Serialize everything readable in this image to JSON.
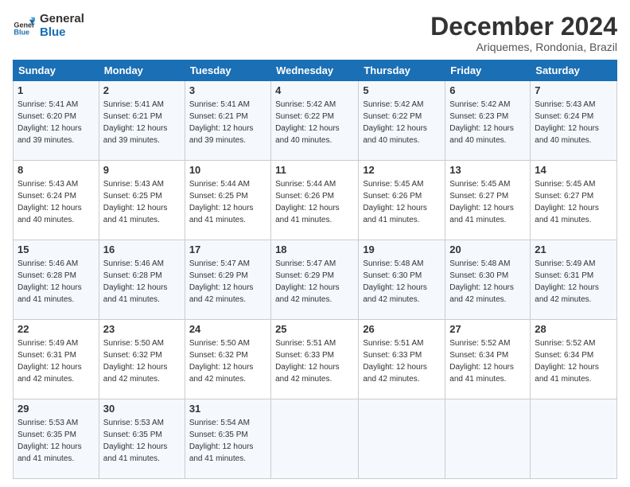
{
  "logo": {
    "text_general": "General",
    "text_blue": "Blue"
  },
  "header": {
    "month": "December 2024",
    "location": "Ariquemes, Rondonia, Brazil"
  },
  "days_of_week": [
    "Sunday",
    "Monday",
    "Tuesday",
    "Wednesday",
    "Thursday",
    "Friday",
    "Saturday"
  ],
  "weeks": [
    [
      {
        "day": "1",
        "sunrise": "5:41 AM",
        "sunset": "6:20 PM",
        "daylight": "12 hours and 39 minutes."
      },
      {
        "day": "2",
        "sunrise": "5:41 AM",
        "sunset": "6:21 PM",
        "daylight": "12 hours and 39 minutes."
      },
      {
        "day": "3",
        "sunrise": "5:41 AM",
        "sunset": "6:21 PM",
        "daylight": "12 hours and 39 minutes."
      },
      {
        "day": "4",
        "sunrise": "5:42 AM",
        "sunset": "6:22 PM",
        "daylight": "12 hours and 40 minutes."
      },
      {
        "day": "5",
        "sunrise": "5:42 AM",
        "sunset": "6:22 PM",
        "daylight": "12 hours and 40 minutes."
      },
      {
        "day": "6",
        "sunrise": "5:42 AM",
        "sunset": "6:23 PM",
        "daylight": "12 hours and 40 minutes."
      },
      {
        "day": "7",
        "sunrise": "5:43 AM",
        "sunset": "6:24 PM",
        "daylight": "12 hours and 40 minutes."
      }
    ],
    [
      {
        "day": "8",
        "sunrise": "5:43 AM",
        "sunset": "6:24 PM",
        "daylight": "12 hours and 40 minutes."
      },
      {
        "day": "9",
        "sunrise": "5:43 AM",
        "sunset": "6:25 PM",
        "daylight": "12 hours and 41 minutes."
      },
      {
        "day": "10",
        "sunrise": "5:44 AM",
        "sunset": "6:25 PM",
        "daylight": "12 hours and 41 minutes."
      },
      {
        "day": "11",
        "sunrise": "5:44 AM",
        "sunset": "6:26 PM",
        "daylight": "12 hours and 41 minutes."
      },
      {
        "day": "12",
        "sunrise": "5:45 AM",
        "sunset": "6:26 PM",
        "daylight": "12 hours and 41 minutes."
      },
      {
        "day": "13",
        "sunrise": "5:45 AM",
        "sunset": "6:27 PM",
        "daylight": "12 hours and 41 minutes."
      },
      {
        "day": "14",
        "sunrise": "5:45 AM",
        "sunset": "6:27 PM",
        "daylight": "12 hours and 41 minutes."
      }
    ],
    [
      {
        "day": "15",
        "sunrise": "5:46 AM",
        "sunset": "6:28 PM",
        "daylight": "12 hours and 41 minutes."
      },
      {
        "day": "16",
        "sunrise": "5:46 AM",
        "sunset": "6:28 PM",
        "daylight": "12 hours and 41 minutes."
      },
      {
        "day": "17",
        "sunrise": "5:47 AM",
        "sunset": "6:29 PM",
        "daylight": "12 hours and 42 minutes."
      },
      {
        "day": "18",
        "sunrise": "5:47 AM",
        "sunset": "6:29 PM",
        "daylight": "12 hours and 42 minutes."
      },
      {
        "day": "19",
        "sunrise": "5:48 AM",
        "sunset": "6:30 PM",
        "daylight": "12 hours and 42 minutes."
      },
      {
        "day": "20",
        "sunrise": "5:48 AM",
        "sunset": "6:30 PM",
        "daylight": "12 hours and 42 minutes."
      },
      {
        "day": "21",
        "sunrise": "5:49 AM",
        "sunset": "6:31 PM",
        "daylight": "12 hours and 42 minutes."
      }
    ],
    [
      {
        "day": "22",
        "sunrise": "5:49 AM",
        "sunset": "6:31 PM",
        "daylight": "12 hours and 42 minutes."
      },
      {
        "day": "23",
        "sunrise": "5:50 AM",
        "sunset": "6:32 PM",
        "daylight": "12 hours and 42 minutes."
      },
      {
        "day": "24",
        "sunrise": "5:50 AM",
        "sunset": "6:32 PM",
        "daylight": "12 hours and 42 minutes."
      },
      {
        "day": "25",
        "sunrise": "5:51 AM",
        "sunset": "6:33 PM",
        "daylight": "12 hours and 42 minutes."
      },
      {
        "day": "26",
        "sunrise": "5:51 AM",
        "sunset": "6:33 PM",
        "daylight": "12 hours and 42 minutes."
      },
      {
        "day": "27",
        "sunrise": "5:52 AM",
        "sunset": "6:34 PM",
        "daylight": "12 hours and 41 minutes."
      },
      {
        "day": "28",
        "sunrise": "5:52 AM",
        "sunset": "6:34 PM",
        "daylight": "12 hours and 41 minutes."
      }
    ],
    [
      {
        "day": "29",
        "sunrise": "5:53 AM",
        "sunset": "6:35 PM",
        "daylight": "12 hours and 41 minutes."
      },
      {
        "day": "30",
        "sunrise": "5:53 AM",
        "sunset": "6:35 PM",
        "daylight": "12 hours and 41 minutes."
      },
      {
        "day": "31",
        "sunrise": "5:54 AM",
        "sunset": "6:35 PM",
        "daylight": "12 hours and 41 minutes."
      },
      null,
      null,
      null,
      null
    ]
  ],
  "labels": {
    "sunrise": "Sunrise:",
    "sunset": "Sunset:",
    "daylight": "Daylight:"
  }
}
